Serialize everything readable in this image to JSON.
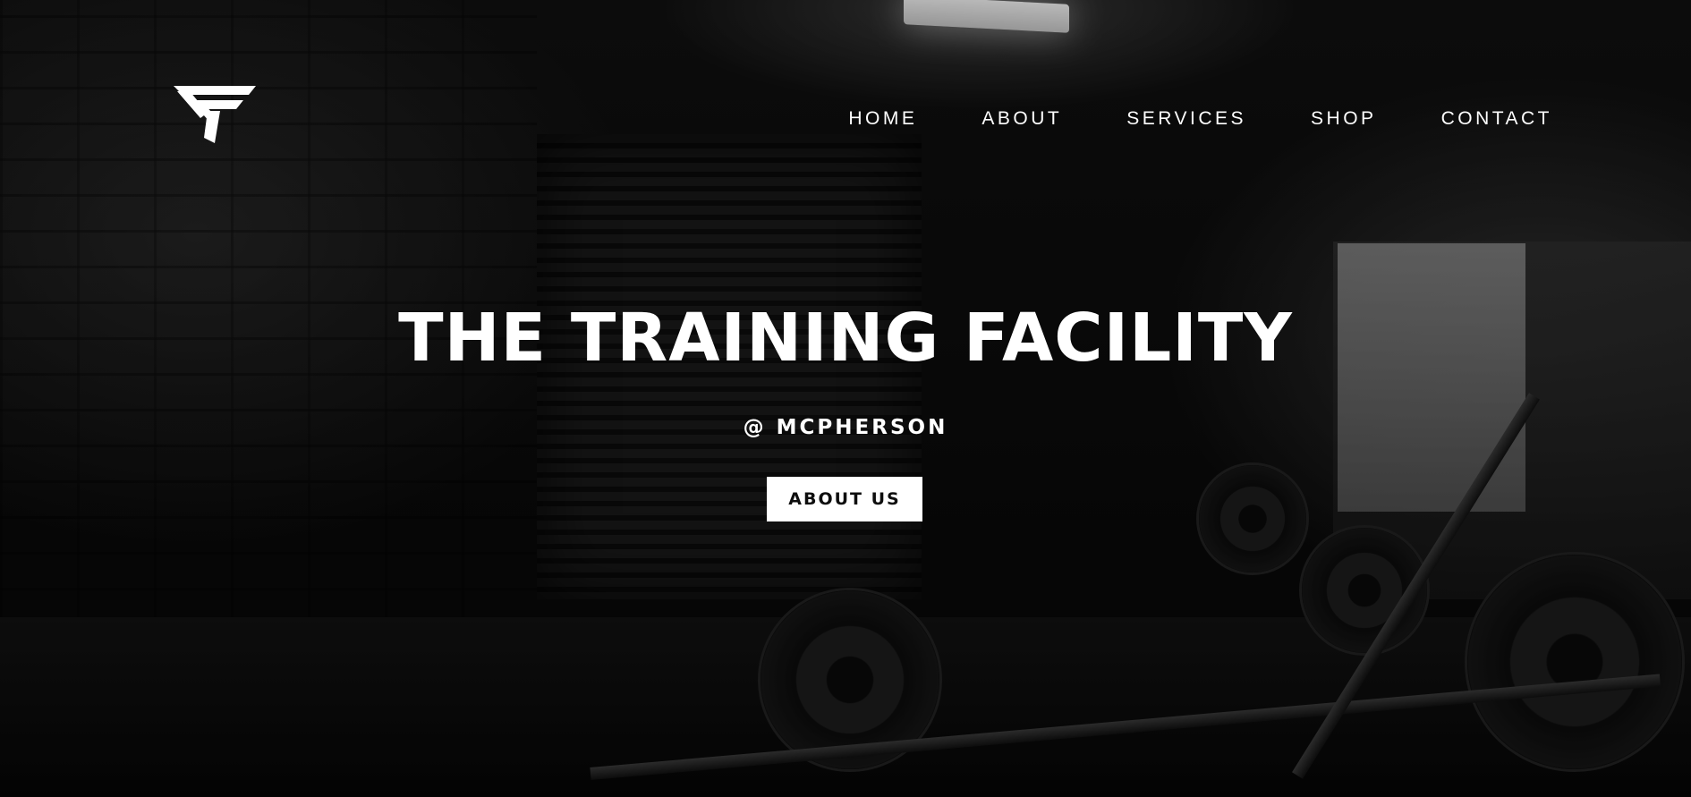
{
  "brand": {
    "logo_icon": "tf-monogram-logo"
  },
  "nav": {
    "items": [
      {
        "label": "HOME"
      },
      {
        "label": "ABOUT"
      },
      {
        "label": "SERVICES"
      },
      {
        "label": "SHOP"
      },
      {
        "label": "CONTACT"
      }
    ]
  },
  "hero": {
    "title": "THE TRAINING FACILITY",
    "subtitle": "@ MCPHERSON",
    "cta_label": "ABOUT US",
    "background_image": "gym-interior-photo"
  },
  "colors": {
    "text": "#ffffff",
    "button_bg": "#ffffff",
    "button_text": "#0e0e0e",
    "background": "#050505"
  }
}
